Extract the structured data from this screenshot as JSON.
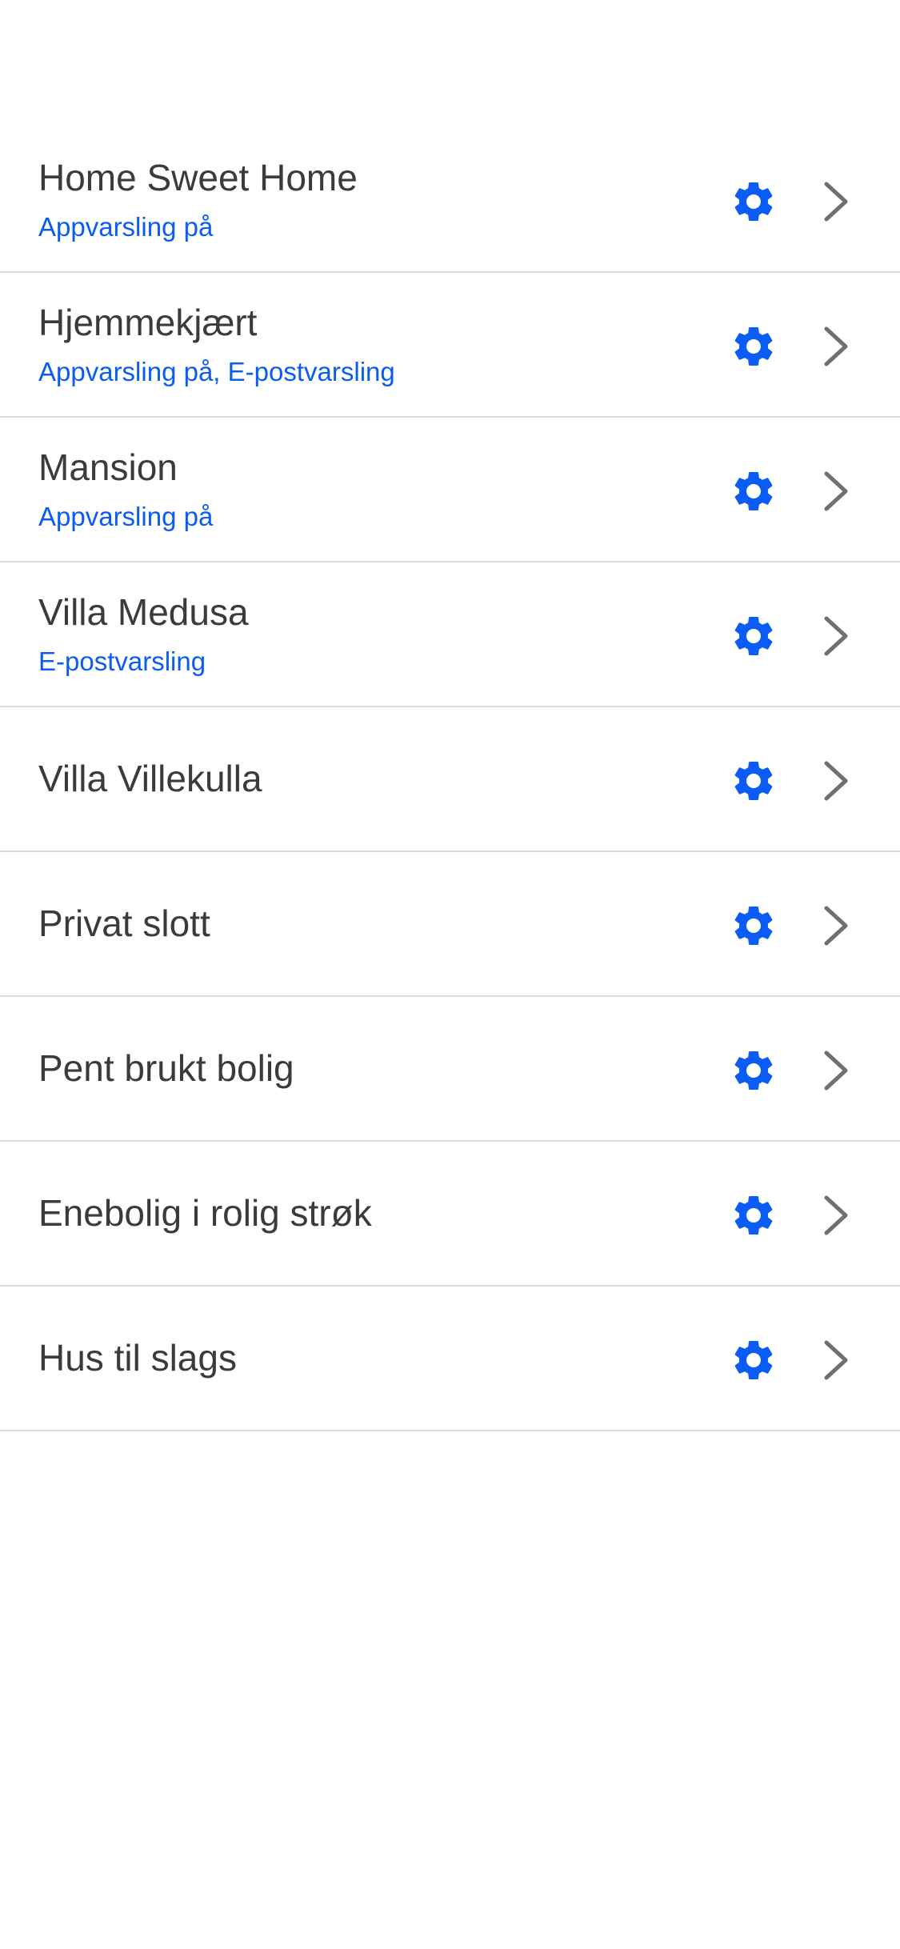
{
  "colors": {
    "accent": "#0a5cf5",
    "chevron": "#707070",
    "title": "#3b3b3b",
    "divider": "#dcdcdc"
  },
  "icons": {
    "settings": "gear-icon",
    "navigate": "chevron-right-icon"
  },
  "homes": [
    {
      "name": "Home Sweet Home",
      "subtitle": "Appvarsling på"
    },
    {
      "name": "Hjemmekjært",
      "subtitle": "Appvarsling på, E-postvarsling"
    },
    {
      "name": "Mansion",
      "subtitle": "Appvarsling på"
    },
    {
      "name": "Villa Medusa",
      "subtitle": "E-postvarsling"
    },
    {
      "name": "Villa Villekulla",
      "subtitle": ""
    },
    {
      "name": "Privat slott",
      "subtitle": ""
    },
    {
      "name": "Pent brukt bolig",
      "subtitle": ""
    },
    {
      "name": "Enebolig i rolig strøk",
      "subtitle": ""
    },
    {
      "name": "Hus til slags",
      "subtitle": ""
    }
  ]
}
